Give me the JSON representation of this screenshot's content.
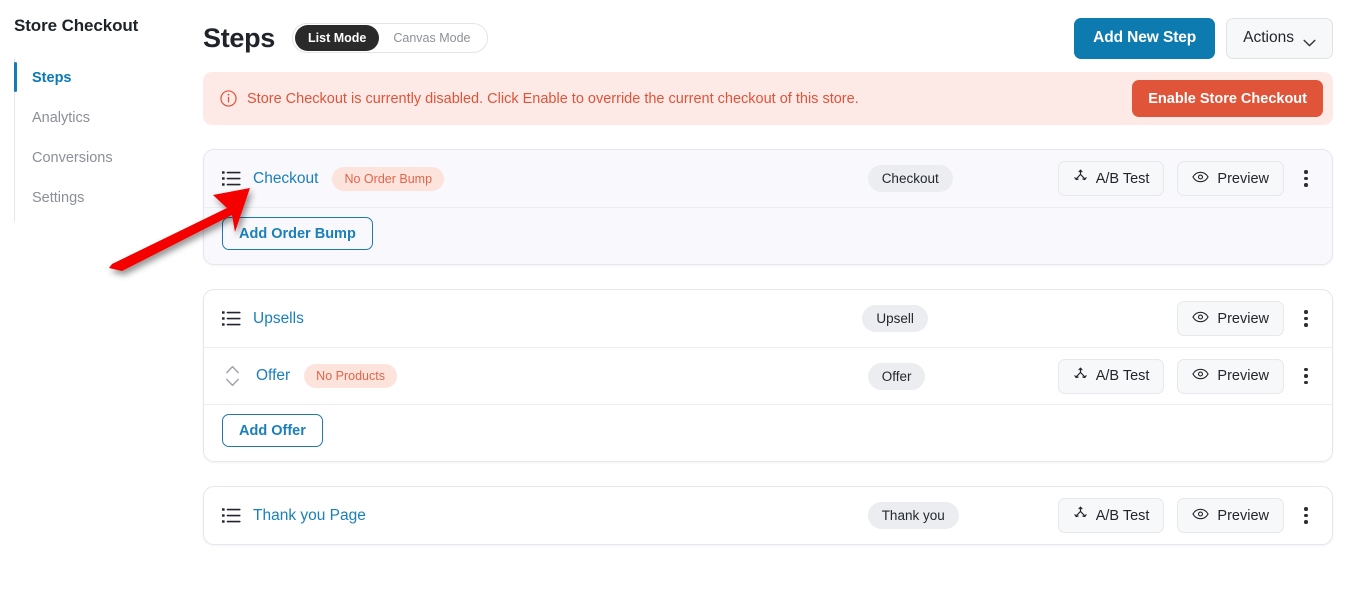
{
  "sidebar": {
    "title": "Store Checkout",
    "items": [
      {
        "label": "Steps",
        "active": true
      },
      {
        "label": "Analytics",
        "active": false
      },
      {
        "label": "Conversions",
        "active": false
      },
      {
        "label": "Settings",
        "active": false
      }
    ]
  },
  "header": {
    "page_title": "Steps",
    "mode_toggle": {
      "active": "List Mode",
      "inactive": "Canvas Mode"
    },
    "add_new_step_label": "Add New Step",
    "actions_label": "Actions",
    "chevron_icon": "chevron-down-icon"
  },
  "banner": {
    "icon": "info-circle-icon",
    "message": "Store Checkout is currently disabled. Click Enable to override the current checkout of this store.",
    "button_label": "Enable Store Checkout",
    "bg_color": "#fdeae6",
    "text_color": "#e0533a",
    "button_color": "#e0543a"
  },
  "steps": [
    {
      "name": "Checkout",
      "handle_icon": "list-drag-icon",
      "warning_tag": "No Order Bump",
      "type_tag": "Checkout",
      "ab_test_label": "A/B Test",
      "preview_label": "Preview",
      "has_ab_test": true,
      "highlighted": true,
      "action_button": "Add Order Bump",
      "children": []
    },
    {
      "name": "Upsells",
      "handle_icon": "list-drag-icon",
      "warning_tag": "",
      "type_tag": "Upsell",
      "ab_test_label": "",
      "preview_label": "Preview",
      "has_ab_test": false,
      "highlighted": false,
      "action_button": "Add Offer",
      "children": [
        {
          "name": "Offer",
          "handle_icon": "sort-updown-icon",
          "warning_tag": "No Products",
          "type_tag": "Offer",
          "ab_test_label": "A/B Test",
          "preview_label": "Preview",
          "has_ab_test": true
        }
      ]
    },
    {
      "name": "Thank you Page",
      "handle_icon": "list-drag-icon",
      "warning_tag": "",
      "type_tag": "Thank you",
      "ab_test_label": "A/B Test",
      "preview_label": "Preview",
      "has_ab_test": true,
      "highlighted": false,
      "action_button": "",
      "children": []
    }
  ],
  "annotation": {
    "type": "red-arrow",
    "color": "#f00000",
    "points_to": "checkout-step-drag-icon"
  },
  "icons": {
    "ab_test": "ab-split-icon",
    "preview": "eye-icon",
    "kebab": "more-vertical-icon"
  },
  "colors": {
    "accent_blue": "#0d7ab0",
    "link_blue": "#1a7fba",
    "danger": "#e0543a",
    "card_highlight": "#f9f9fd"
  }
}
